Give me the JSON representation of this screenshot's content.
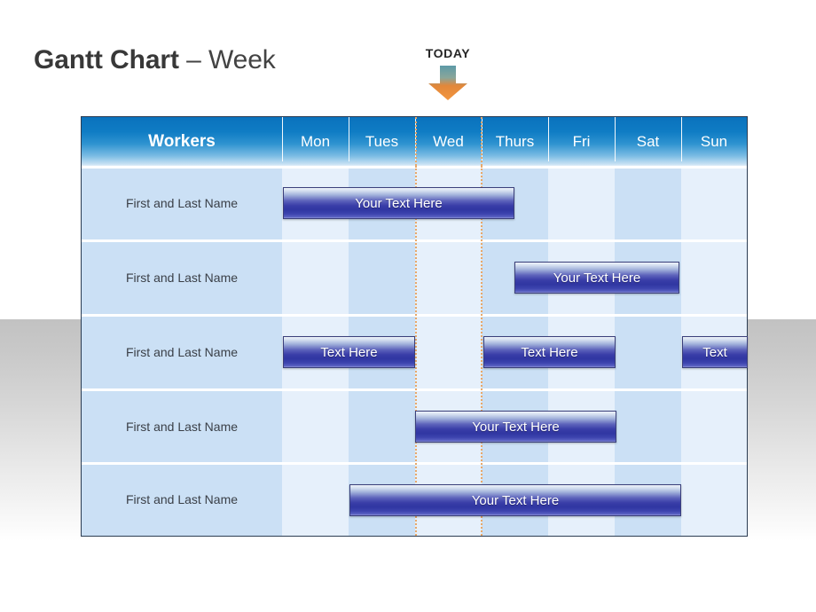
{
  "title": {
    "strong": "Gantt Chart",
    "light": " – Week"
  },
  "today_marker": {
    "label": "TODAY",
    "icon": "down-arrow-icon",
    "column": "Wed",
    "arrow_top_color": "#5d9aa8",
    "arrow_bottom_color": "#f0913c"
  },
  "table": {
    "header": {
      "workers_label": "Workers",
      "days": [
        "Mon",
        "Tues",
        "Wed",
        "Thurs",
        "Fri",
        "Sat",
        "Sun"
      ],
      "header_bg_top": "#0a72bd",
      "header_bg_bottom": "#e4f0fa"
    },
    "colors": {
      "name_column_bg": "#cbe0f5",
      "column_light": "#e6f0fb",
      "column_dark": "#cbe0f5",
      "bar_accent": "#3036a2",
      "today_line": "#e8a86a",
      "table_border": "#2b3c52"
    },
    "rows": [
      {
        "name": "First and Last Name",
        "bars": [
          {
            "label": "Your Text Here",
            "start_day": "Mon",
            "end_day": "Wed"
          }
        ]
      },
      {
        "name": "First and Last Name",
        "bars": [
          {
            "label": "Your Text Here",
            "start_day": "Thurs",
            "end_day": "Fri"
          }
        ]
      },
      {
        "name": "First and Last Name",
        "bars": [
          {
            "label": "Text Here",
            "start_day": "Mon",
            "end_day": "Tues"
          },
          {
            "label": "Text Here",
            "start_day": "Thurs",
            "end_day": "Fri"
          },
          {
            "label": "Text",
            "start_day": "Sun",
            "end_day": "Sun"
          }
        ]
      },
      {
        "name": "First and Last Name",
        "bars": [
          {
            "label": "Your Text Here",
            "start_day": "Wed",
            "end_day": "Thurs"
          }
        ]
      },
      {
        "name": "First and Last Name",
        "bars": [
          {
            "label": "Your Text Here",
            "start_day": "Tues",
            "end_day": "Sat"
          }
        ]
      }
    ]
  },
  "chart_data": {
    "type": "bar",
    "title": "Gantt Chart – Week",
    "categories": [
      "Mon",
      "Tues",
      "Wed",
      "Thurs",
      "Fri",
      "Sat",
      "Sun"
    ],
    "xlabel": "",
    "ylabel": "Workers",
    "grid": true,
    "legend": "none",
    "today": "Wed",
    "series": [
      {
        "name": "First and Last Name",
        "tasks": [
          {
            "label": "Your Text Here",
            "start": "Mon",
            "end": "Wed",
            "span_days": 2.5
          }
        ]
      },
      {
        "name": "First and Last Name",
        "tasks": [
          {
            "label": "Your Text Here",
            "start": "Thurs",
            "end": "Fri",
            "span_days": 2.5
          }
        ]
      },
      {
        "name": "First and Last Name",
        "tasks": [
          {
            "label": "Text Here",
            "start": "Mon",
            "end": "Tues",
            "span_days": 2
          },
          {
            "label": "Text Here",
            "start": "Thurs",
            "end": "Fri",
            "span_days": 2
          },
          {
            "label": "Text",
            "start": "Sun",
            "end": "Sun",
            "span_days": 1
          }
        ]
      },
      {
        "name": "First and Last Name",
        "tasks": [
          {
            "label": "Your Text Here",
            "start": "Wed",
            "end": "Thurs",
            "span_days": 3
          }
        ]
      },
      {
        "name": "First and Last Name",
        "tasks": [
          {
            "label": "Your Text Here",
            "start": "Tues",
            "end": "Sat",
            "span_days": 5
          }
        ]
      }
    ]
  }
}
